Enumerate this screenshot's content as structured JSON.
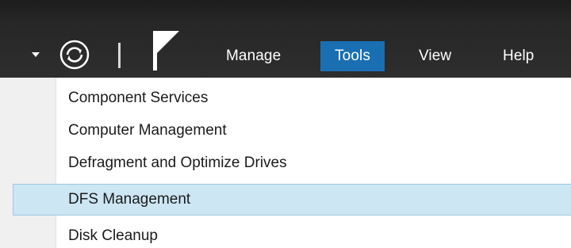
{
  "toolbar": {
    "refresh_icon": "refresh-icon",
    "flag_icon": "notifications-flag-icon",
    "dropdown_icon": "dropdown-arrow-icon"
  },
  "menu": {
    "items": [
      {
        "label": "Manage"
      },
      {
        "label": "Tools"
      },
      {
        "label": "View"
      },
      {
        "label": "Help"
      }
    ],
    "active": "Tools",
    "active_color": "#1a6fb3"
  },
  "tools_menu": {
    "items": [
      {
        "label": "Component Services"
      },
      {
        "label": "Computer Management"
      },
      {
        "label": "Defragment and Optimize Drives"
      },
      {
        "label": "DFS Management"
      },
      {
        "label": "Disk Cleanup"
      }
    ],
    "highlighted": "DFS Management",
    "highlight_color": "#cde6f3"
  }
}
